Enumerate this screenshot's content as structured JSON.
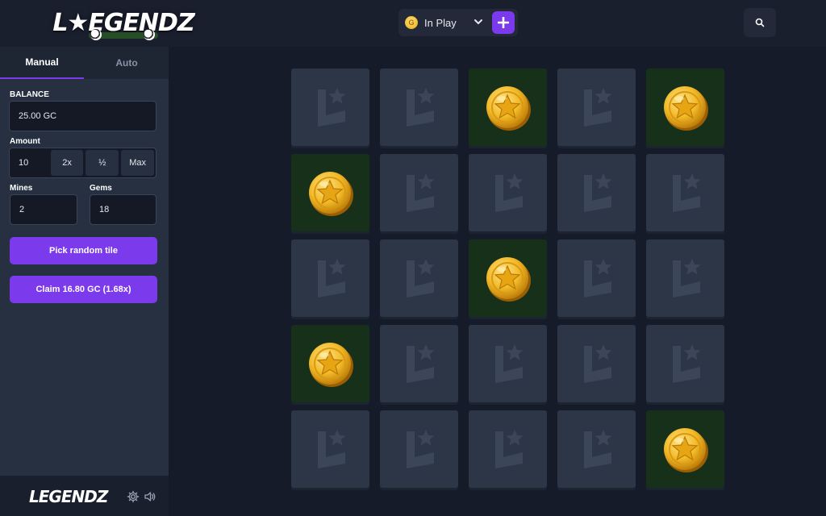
{
  "header": {
    "logo_text": "L★EGENDZ",
    "currency_label": "In Play",
    "currency_icon": "coin-icon"
  },
  "sidebar": {
    "tabs": [
      {
        "label": "Manual",
        "active": true
      },
      {
        "label": "Auto",
        "active": false
      }
    ],
    "balance_label": "BALANCE",
    "balance_value": "25.00 GC",
    "amount_label": "Amount",
    "amount_value": "10",
    "amount_buttons": [
      "2x",
      "½",
      "Max"
    ],
    "mines_label": "Mines",
    "mines_value": "2",
    "gems_label": "Gems",
    "gems_value": "18",
    "pick_random_label": "Pick random tile",
    "claim_label": "Claim 16.80 GC (1.68x)",
    "footer_logo": "LEGENDZ"
  },
  "grid": {
    "rows": 5,
    "cols": 5,
    "tiles": [
      "hidden",
      "hidden",
      "coin",
      "hidden",
      "coin",
      "coin",
      "hidden",
      "hidden",
      "hidden",
      "hidden",
      "hidden",
      "hidden",
      "coin",
      "hidden",
      "hidden",
      "coin",
      "hidden",
      "hidden",
      "hidden",
      "hidden",
      "hidden",
      "hidden",
      "hidden",
      "hidden",
      "coin"
    ]
  },
  "colors": {
    "accent": "#7c3aed",
    "tile_hidden": "#2c3647",
    "tile_revealed": "#173019",
    "coin_gold": "#f2b927"
  }
}
